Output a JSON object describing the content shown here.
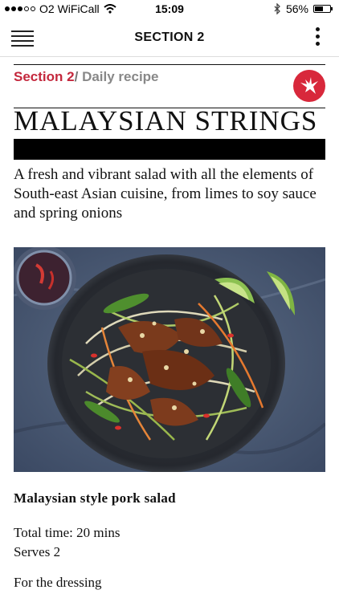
{
  "status": {
    "carrier": "O2 WiFiCall",
    "time": "15:09",
    "battery_text": "56%",
    "battery_level": 0.56
  },
  "nav": {
    "title": "SECTION 2"
  },
  "breadcrumb": {
    "section": "Section 2",
    "separator": "/",
    "page": "Daily recipe"
  },
  "article": {
    "headline": "MALAYSIAN STRINGS",
    "standfirst": "A fresh and vibrant salad with all the elements of South-east Asian cuisine, from limes to soy sauce and spring onions",
    "caption": "Malaysian style pork salad",
    "total_time": "Total time: 20 mins",
    "serves": "Serves 2",
    "dressing_heading": "For the dressing"
  },
  "colors": {
    "accent": "#c4283d",
    "logo_red": "#d8283b"
  },
  "icons": {
    "menu": "hamburger-icon",
    "more": "vertical-dots-icon",
    "wifi": "wifi-icon",
    "bluetooth": "bluetooth-icon",
    "battery": "battery-icon",
    "logo": "eagle-logo-icon"
  }
}
